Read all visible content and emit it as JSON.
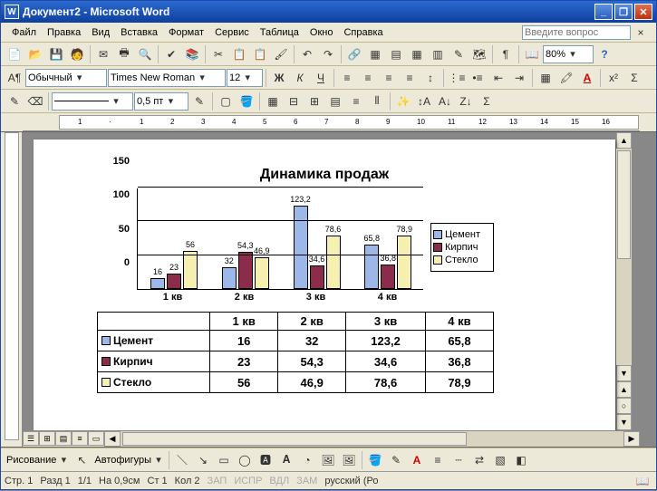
{
  "title": "Документ2 - Microsoft Word",
  "menu": [
    "Файл",
    "Правка",
    "Вид",
    "Вставка",
    "Формат",
    "Сервис",
    "Таблица",
    "Окно",
    "Справка"
  ],
  "question_ph": "Введите вопрос",
  "style_combo": "Обычный",
  "font_combo": "Times New Roman",
  "size_combo": "12",
  "zoom": "80%",
  "pt_combo": "0,5 пт",
  "draw_label": "Рисование",
  "autoshapes": "Автофигуры",
  "status": {
    "page": "Стр. 1",
    "sec": "Разд 1",
    "pp": "1/1",
    "at": "На 0,9см",
    "ln": "Ст 1",
    "col": "Кол 2",
    "rec": "ЗАП",
    "trk": "ИСПР",
    "ext": "ВДЛ",
    "ovr": "ЗАМ",
    "lang": "русский (Ро"
  },
  "chart_data": {
    "type": "bar",
    "title": "Динамика продаж",
    "categories": [
      "1 кв",
      "2 кв",
      "3 кв",
      "4 кв"
    ],
    "series": [
      {
        "name": "Цемент",
        "color": "#9db8e8",
        "values": [
          16,
          32,
          123.2,
          65.8
        ],
        "labels": [
          "16",
          "32",
          "123,2",
          "65,8"
        ]
      },
      {
        "name": "Кирпич",
        "color": "#8b2d4a",
        "values": [
          23,
          54.3,
          34.6,
          36.8
        ],
        "labels": [
          "23",
          "54,3",
          "34,6",
          "36,8"
        ]
      },
      {
        "name": "Стекло",
        "color": "#f6f0b0",
        "values": [
          56,
          46.9,
          78.6,
          78.9
        ],
        "labels": [
          "56",
          "46,9",
          "78,6",
          "78,9"
        ]
      }
    ],
    "ylim": [
      0,
      150
    ],
    "yticks": [
      0,
      50,
      100,
      150
    ]
  },
  "table": {
    "headers": [
      "",
      "1 кв",
      "2 кв",
      "3 кв",
      "4 кв"
    ],
    "rows": [
      {
        "name": "Цемент",
        "c": "c0",
        "cells": [
          "16",
          "32",
          "123,2",
          "65,8"
        ]
      },
      {
        "name": "Кирпич",
        "c": "c1",
        "cells": [
          "23",
          "54,3",
          "34,6",
          "36,8"
        ]
      },
      {
        "name": "Стекло",
        "c": "c2",
        "cells": [
          "56",
          "46,9",
          "78,6",
          "78,9"
        ]
      }
    ]
  }
}
